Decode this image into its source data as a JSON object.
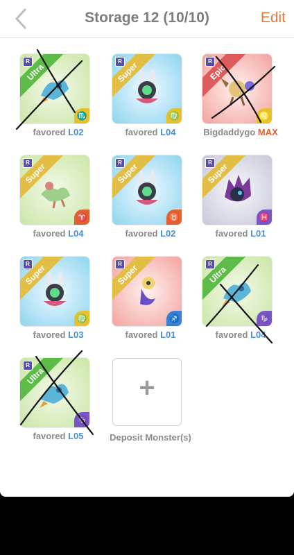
{
  "header": {
    "title": "Storage 12 (10/10)",
    "edit_label": "Edit"
  },
  "monsters": [
    {
      "rarity": "Ultra",
      "name": "favored",
      "level": "L02",
      "sign": "♏"
    },
    {
      "rarity": "Super",
      "name": "favored",
      "level": "L04",
      "sign": "♍"
    },
    {
      "rarity": "Epic",
      "name": "Bigdaddygo",
      "level": "MAX",
      "sign": "♌"
    },
    {
      "rarity": "Super",
      "name": "favored",
      "level": "L04",
      "sign": "♈"
    },
    {
      "rarity": "Super",
      "name": "favored",
      "level": "L02",
      "sign": "♉"
    },
    {
      "rarity": "Super",
      "name": "favored",
      "level": "L01",
      "sign": "♓"
    },
    {
      "rarity": "Super",
      "name": "favored",
      "level": "L03",
      "sign": "♍"
    },
    {
      "rarity": "Super",
      "name": "favored",
      "level": "L01",
      "sign": "♐"
    },
    {
      "rarity": "Ultra",
      "name": "favored",
      "level": "L04",
      "sign": "♑"
    },
    {
      "rarity": "Ultra",
      "name": "favored",
      "level": "L05",
      "sign": "♑"
    }
  ],
  "deposit": {
    "plus": "+",
    "label": "Deposit Monster(s)"
  },
  "rare_badge": "R",
  "colors": {
    "accent": "#e0793b",
    "level": "#4a8fd6",
    "max": "#e0622f"
  }
}
